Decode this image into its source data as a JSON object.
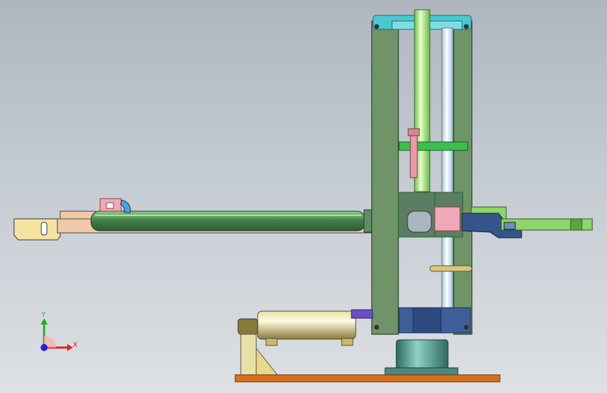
{
  "viewport": {
    "background_top": "#aeb6c0",
    "background_bottom": "#dde0e4"
  },
  "triad": {
    "x_label": "X",
    "y_label": "Y",
    "x_color": "#e02020",
    "y_color": "#20b020",
    "z_color": "#2020e0"
  },
  "model": {
    "colors": {
      "column": "#6f9468",
      "arm": "#4f8050",
      "gripper_arm": "#f2c9a6",
      "rod_green": "#8fd56a",
      "rod_blue": "#c9e3f0",
      "base_plate": "#d8701e",
      "cylinder_gold": "#c8b86a",
      "top_cap": "#4ac8d0",
      "bracket_green": "#3cbf4e",
      "clamp_blue": "#35558a",
      "pink": "#e79aa8"
    }
  }
}
